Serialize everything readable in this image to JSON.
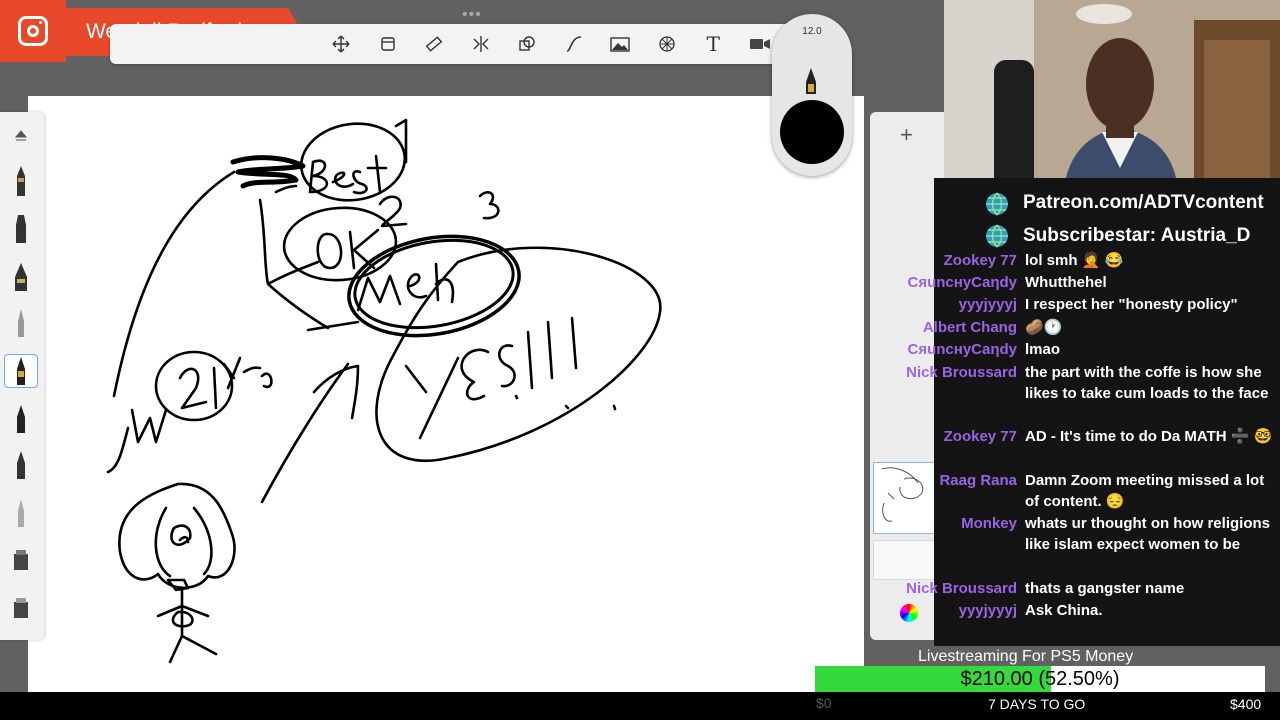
{
  "streamer": {
    "name": "Wendell Radford"
  },
  "toolbar": {
    "tools": [
      "move-icon",
      "transform-icon",
      "ruler-icon",
      "symmetry-icon",
      "shape-icon",
      "curve-icon",
      "image-icon",
      "perspective-icon",
      "text-icon",
      "video-icon"
    ],
    "text_glyph": "T"
  },
  "brush": {
    "size": "12.0",
    "color": "#000000"
  },
  "layers": {
    "add_label": "+"
  },
  "chat": {
    "links": [
      "Patreon.com/ADTVcontent",
      "Subscribestar: Austria_D"
    ],
    "messages": [
      {
        "user": "Zookey 77",
        "text": "lol smh 🤦 😂"
      },
      {
        "user": "CяuncнуCaηdy",
        "text": "Whutthehel"
      },
      {
        "user": "yyyjyyyj",
        "text": "I respect her \"honesty policy\""
      },
      {
        "user": "Albert Chang",
        "text": "🥔🕐"
      },
      {
        "user": "CяuncнуCaηdy",
        "text": "lmao"
      },
      {
        "user": "Nick Broussard",
        "text": "the part with the coffe is how she likes to take cum loads to the face"
      },
      {
        "user": "Zookey 77",
        "text": "AD - It's time to do Da MATH ➗ 🤓"
      },
      {
        "user": "Raag Rana",
        "text": "Damn Zoom meeting missed a lot of content. 😔"
      },
      {
        "user": "Monkey",
        "text": "whats ur thought on how religions like islam expect women to be"
      },
      {
        "user": "Nick Broussard",
        "text": "thats a gangster name"
      },
      {
        "user": "yyyjyyyj",
        "text": "Ask China."
      }
    ]
  },
  "goal": {
    "title": "Livestreaming For PS5 Money",
    "amount": "$210.00 (52.50%)",
    "progress": 0.525,
    "days_left": "7 DAYS TO GO",
    "min": "$0",
    "max": "$400"
  },
  "colors": {
    "brand": "#e8492a",
    "username": "#9c62e5",
    "goal_fill": "#35d93b"
  }
}
